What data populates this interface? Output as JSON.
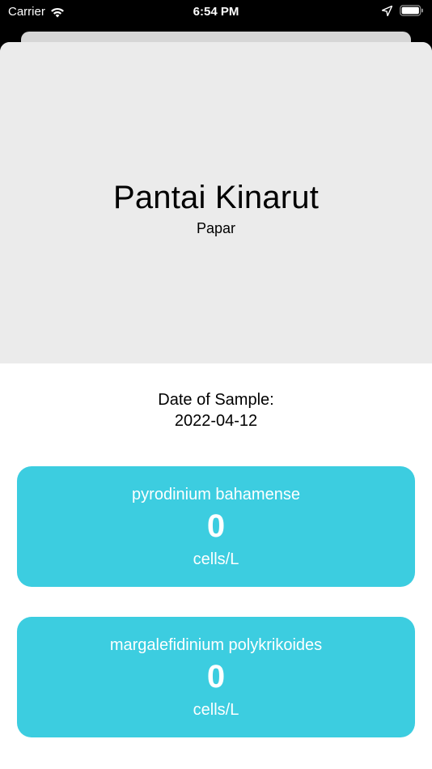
{
  "status_bar": {
    "carrier": "Carrier",
    "time": "6:54 PM",
    "wifi_icon": "wifi-icon",
    "location_icon": "location-arrow-icon",
    "battery_icon": "battery-icon"
  },
  "site": {
    "name": "Pantai Kinarut",
    "district": "Papar"
  },
  "sample": {
    "date_label": "Date of Sample:",
    "date_value": "2022-04-12"
  },
  "species": [
    {
      "name": "pyrodinium bahamense",
      "count": "0",
      "unit": "cells/L"
    },
    {
      "name": "margalefidinium polykrikoides",
      "count": "0",
      "unit": "cells/L"
    }
  ],
  "colors": {
    "card_accent": "#3ccde0",
    "hero_background": "#ebebeb",
    "status_bar_background": "#000000"
  }
}
